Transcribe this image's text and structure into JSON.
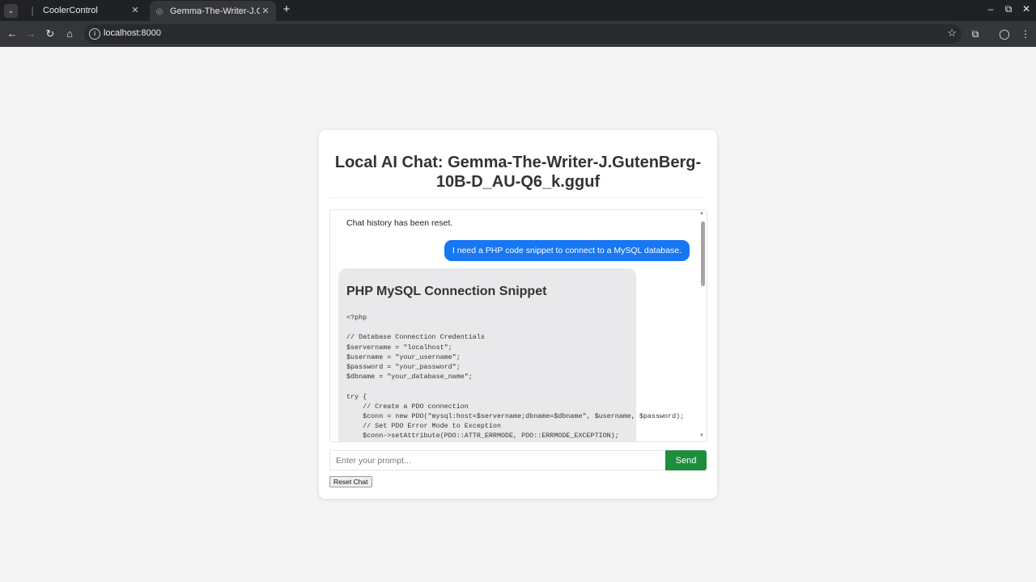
{
  "browser": {
    "tabs": [
      {
        "title": "CoolerControl",
        "active": false
      },
      {
        "title": "Gemma-The-Writer-J.C",
        "active": true
      }
    ],
    "url": "localhost:8000"
  },
  "page": {
    "title": "Local AI Chat: Gemma-The-Writer-J.GutenBerg-10B-D_AU-Q6_k.gguf",
    "messages": {
      "system": "Chat history has been reset.",
      "user": "I need a PHP code snippet to connect to a MySQL database.",
      "bot_heading": "PHP MySQL Connection Snippet",
      "bot_code": "<?php\n\n// Database Connection Credentials\n$servername = \"localhost\";\n$username = \"your_username\";\n$password = \"your_password\";\n$dbname = \"your_database_name\";\n\ntry {\n    // Create a PDO connection\n    $conn = new PDO(\"mysql:host=$servername;dbname=$dbname\", $username, $password);\n    // Set PDO Error Mode to Exception\n    $conn->setAttribute(PDO::ATTR_ERRMODE, PDO::ERRMODE_EXCEPTION);"
    },
    "prompt_placeholder": "Enter your prompt...",
    "send_label": "Send",
    "reset_label": "Reset Chat"
  },
  "colors": {
    "send_button": "#1e8e3e",
    "user_bubble": "#1877f2",
    "bot_bubble": "#e9e9eb"
  }
}
